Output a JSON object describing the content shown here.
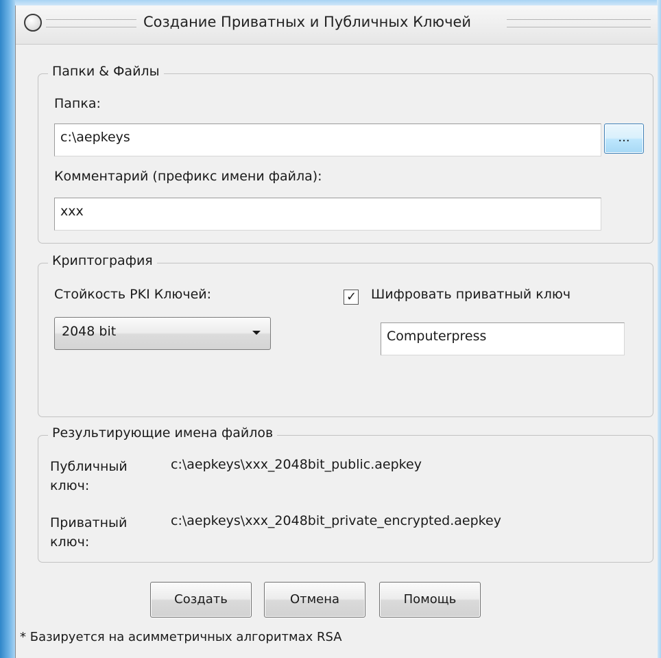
{
  "window": {
    "title": "Создание Приватных и Публичных Ключей"
  },
  "folders": {
    "legend": "Папки & Файлы",
    "folder_label": "Папка:",
    "folder_value": "c:\\aepkeys",
    "browse_label": "...",
    "comment_label": "Комментарий (префикс имени файла):",
    "comment_value": "xxx"
  },
  "crypto": {
    "legend": "Криптография",
    "strength_label": "Стойкость PKI Ключей:",
    "strength_value": "2048 bit",
    "encrypt_checked": true,
    "encrypt_label": "Шифровать приватный ключ",
    "password_value": "Computerpress"
  },
  "results": {
    "legend": "Результирующие имена файлов",
    "public_label_1": "Публичный",
    "public_label_2": "ключ:",
    "public_value": "c:\\aepkeys\\xxx_2048bit_public.aepkey",
    "private_label_1": "Приватный",
    "private_label_2": "ключ:",
    "private_value": "c:\\aepkeys\\xxx_2048bit_private_encrypted.aepkey"
  },
  "buttons": {
    "create": "Создать",
    "cancel": "Отмена",
    "help": "Помощь"
  },
  "footnote": "* Базируется на асимметричных алгоритмах RSA"
}
